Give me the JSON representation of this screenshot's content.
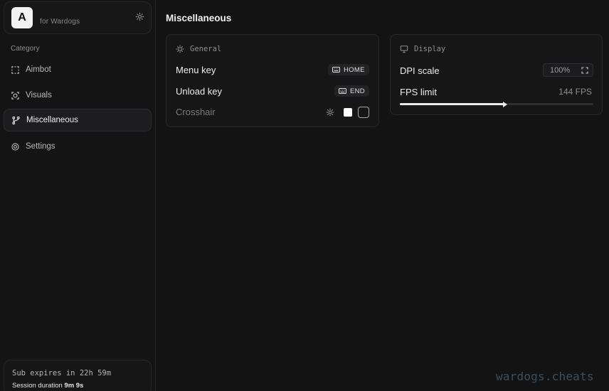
{
  "brand": {
    "logo_letter": "A",
    "subtitle": "for Wardogs"
  },
  "sidebar": {
    "category_label": "Category",
    "items": [
      {
        "label": "Aimbot",
        "icon": "aimbot-frame-icon",
        "active": false
      },
      {
        "label": "Visuals",
        "icon": "visuals-target-icon",
        "active": false
      },
      {
        "label": "Miscellaneous",
        "icon": "misc-branch-icon",
        "active": true
      },
      {
        "label": "Settings",
        "icon": "gear-icon",
        "active": false
      }
    ]
  },
  "subscription": {
    "expires_text": "Sub expires in 22h 59m",
    "session_label": "Session duration",
    "session_value": "9m 9s"
  },
  "page": {
    "title": "Miscellaneous"
  },
  "general": {
    "header": "General",
    "menu_key": {
      "label": "Menu key",
      "key": "HOME"
    },
    "unload_key": {
      "label": "Unload key",
      "key": "END"
    },
    "crosshair": {
      "label": "Crosshair",
      "color": "#ffffff",
      "enabled": false
    }
  },
  "display": {
    "header": "Display",
    "dpi": {
      "label": "DPI scale",
      "value": "100%"
    },
    "fps": {
      "label": "FPS limit",
      "value_text": "144 FPS",
      "fill_fraction": 0.54
    }
  },
  "watermark": "wardogs.cheats",
  "colors": {
    "accent": "#ebebed",
    "background": "#131314",
    "watermark": "#3b4f5e"
  }
}
